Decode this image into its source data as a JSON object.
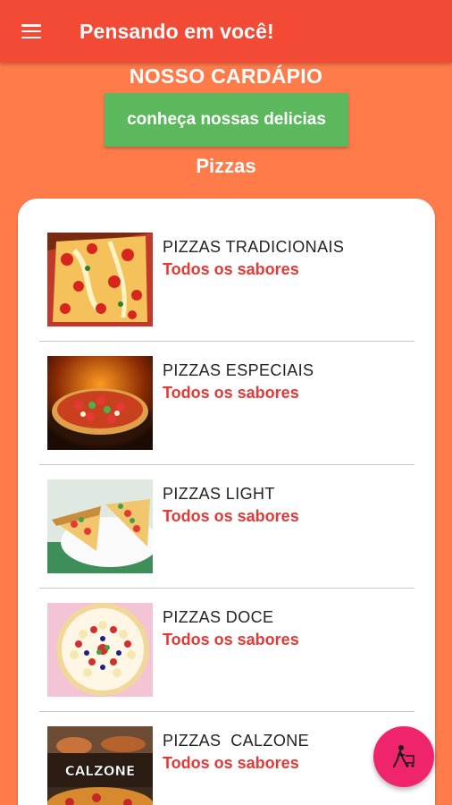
{
  "appbar": {
    "title": "Pensando em você!",
    "menu_icon": "hamburger-menu-icon"
  },
  "header": {
    "title": "NOSSO CARDÁPIO",
    "cta_label": "conheça nossas delicias",
    "category": "Pizzas"
  },
  "menu": {
    "items": [
      {
        "name": "PIZZAS TRADICIONAIS",
        "subtitle": "Todos os sabores"
      },
      {
        "name": "PIZZAS ESPECIAIS",
        "subtitle": "Todos os sabores"
      },
      {
        "name": "PIZZAS LIGHT",
        "subtitle": "Todos os sabores"
      },
      {
        "name": "PIZZAS DOCE",
        "subtitle": "Todos os sabores"
      },
      {
        "name": "PIZZAS  CALZONE",
        "subtitle": "Todos os sabores",
        "image_text": "CALZONE"
      }
    ]
  },
  "fab": {
    "icon": "delivery-person-icon"
  },
  "colors": {
    "background": "#ff7b4a",
    "appbar": "#f34a36",
    "button": "#5cb85c",
    "accent_text": "#e53935",
    "fab": "#f0246c"
  }
}
